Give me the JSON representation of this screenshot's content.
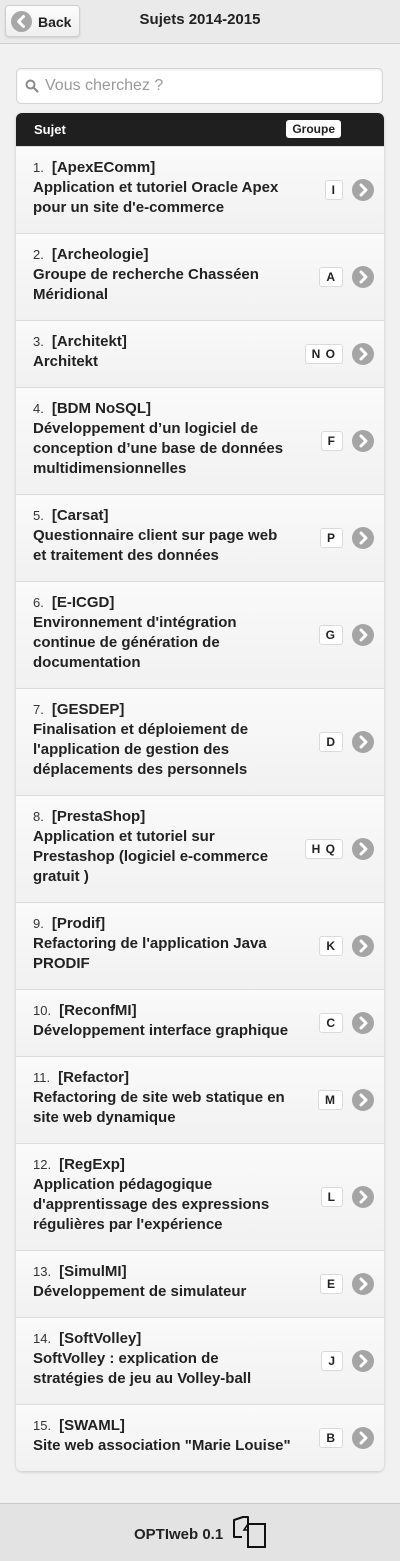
{
  "header": {
    "back_label": "Back",
    "title": "Sujets 2014-2015"
  },
  "search": {
    "placeholder": "Vous cherchez ?",
    "value": ""
  },
  "table": {
    "col_subject": "Sujet",
    "col_group": "Groupe"
  },
  "subjects": [
    {
      "num": "1.",
      "code": "[ApexEComm]",
      "lines": [
        "Application et tutoriel Oracle Apex",
        "pour un site d'e-commerce"
      ],
      "group": "I"
    },
    {
      "num": "2.",
      "code": "[Archeologie]",
      "lines": [
        "Groupe de recherche Chasséen",
        "Méridional"
      ],
      "group": "A"
    },
    {
      "num": "3.",
      "code": "[Architekt]",
      "lines": [
        "Architekt"
      ],
      "group": "N O"
    },
    {
      "num": "4.",
      "code": "[BDM NoSQL]",
      "lines": [
        "Développement d’un logiciel de",
        "conception d’une base de données",
        "multidimensionnelles"
      ],
      "group": "F"
    },
    {
      "num": "5.",
      "code": "[Carsat]",
      "lines": [
        "Questionnaire client sur page web",
        "et traitement des données"
      ],
      "group": "P"
    },
    {
      "num": "6.",
      "code": "[E-ICGD]",
      "lines": [
        "Environnement d'intégration",
        "continue de génération de",
        "documentation"
      ],
      "group": "G"
    },
    {
      "num": "7.",
      "code": "[GESDEP]",
      "lines": [
        "Finalisation et déploiement de",
        "l'application de gestion des",
        "déplacements des personnels"
      ],
      "group": "D"
    },
    {
      "num": "8.",
      "code": "[PrestaShop]",
      "lines": [
        "Application et tutoriel sur",
        "Prestashop (logiciel e-commerce",
        "gratuit )"
      ],
      "group": "H Q"
    },
    {
      "num": "9.",
      "code": "[Prodif]",
      "lines": [
        "Refactoring de l'application Java",
        "PRODIF"
      ],
      "group": "K"
    },
    {
      "num": "10.",
      "code": "[ReconfMI]",
      "lines": [
        "Développement interface graphique"
      ],
      "group": "C"
    },
    {
      "num": "11.",
      "code": "[Refactor]",
      "lines": [
        "Refactoring de site web statique en",
        "site web dynamique"
      ],
      "group": "M"
    },
    {
      "num": "12.",
      "code": "[RegExp]",
      "lines": [
        "Application pédagogique",
        "d'apprentissage des expressions",
        "régulières par l'expérience"
      ],
      "group": "L"
    },
    {
      "num": "13.",
      "code": "[SimulMI]",
      "lines": [
        "Développement de simulateur"
      ],
      "group": "E"
    },
    {
      "num": "14.",
      "code": "[SoftVolley]",
      "lines": [
        "SoftVolley : explication de",
        "stratégies de jeu au Volley-ball"
      ],
      "group": "J"
    },
    {
      "num": "15.",
      "code": "[SWAML]",
      "lines": [
        "Site web association \"Marie Louise\""
      ],
      "group": "B"
    }
  ],
  "footer": {
    "label": "OPTIweb 0.1",
    "icon": "copy-icon"
  },
  "icons": {
    "back": "arrow-left-icon",
    "search": "search-icon",
    "row": "chevron-right-icon"
  },
  "colors": {
    "header_bar": "#1f1f1f",
    "icon_circle": "#a5a5a5",
    "background": "#f1f1f1"
  }
}
